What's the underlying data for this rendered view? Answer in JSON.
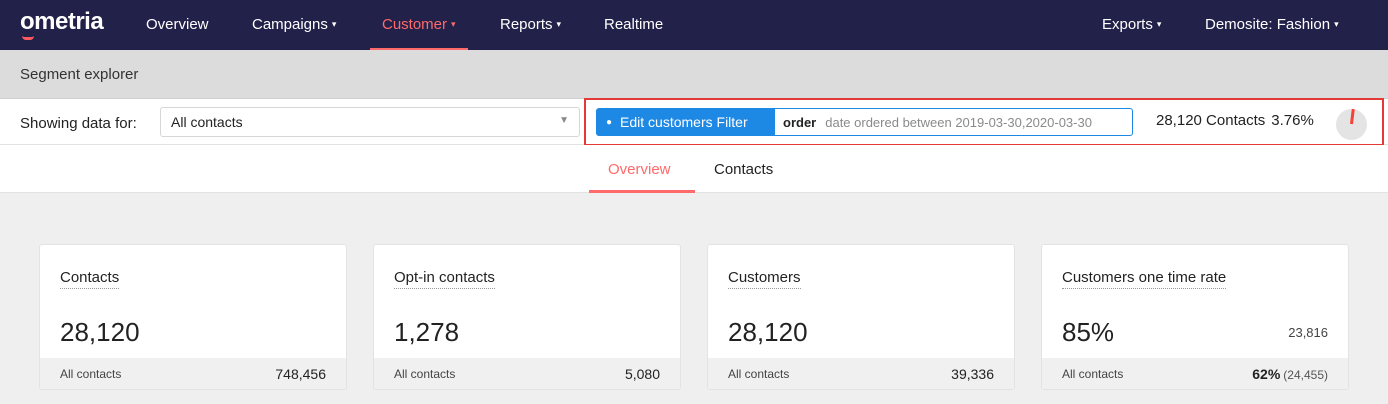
{
  "brand": {
    "name": "ometria",
    "accent": "#ff6a6a",
    "nav_bg": "#22214a",
    "button_blue": "#1e88e5",
    "highlight_red": "#e53935"
  },
  "nav": {
    "items": [
      {
        "label": "Overview"
      },
      {
        "label": "Campaigns"
      },
      {
        "label": "Customer"
      },
      {
        "label": "Reports"
      },
      {
        "label": "Realtime"
      }
    ],
    "exports": "Exports",
    "site": "Demosite: Fashion",
    "active": "Customer",
    "caret": "▾"
  },
  "subheader": {
    "title": "Segment explorer"
  },
  "filter": {
    "showing_label": "Showing data for:",
    "select_value": "All contacts",
    "edit_button": "Edit customers Filter",
    "filter_keyword": "order",
    "filter_rule": "date ordered between 2019-03-30,2020-03-30",
    "contacts_count": "28,120 Contacts",
    "contacts_pct": "3.76%",
    "pie_fraction": 0.0376
  },
  "tabs": [
    {
      "label": "Overview",
      "active": true
    },
    {
      "label": "Contacts",
      "active": false
    }
  ],
  "cards": [
    {
      "title": "Contacts",
      "value": "28,120",
      "side": "",
      "foot_label": "All contacts",
      "foot_value": "748,456",
      "foot_sub": ""
    },
    {
      "title": "Opt-in contacts",
      "value": "1,278",
      "side": "",
      "foot_label": "All contacts",
      "foot_value": "5,080",
      "foot_sub": ""
    },
    {
      "title": "Customers",
      "value": "28,120",
      "side": "",
      "foot_label": "All contacts",
      "foot_value": "39,336",
      "foot_sub": ""
    },
    {
      "title": "Customers one time rate",
      "value": "85%",
      "side": "23,816",
      "foot_label": "All contacts",
      "foot_value": "62%",
      "foot_sub": "(24,455)"
    }
  ]
}
